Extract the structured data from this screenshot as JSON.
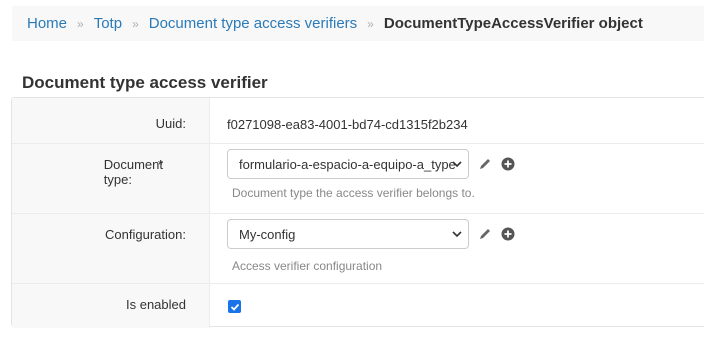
{
  "breadcrumbs": {
    "items": [
      "Home",
      "Totp",
      "Document type access verifiers"
    ],
    "separator": "»",
    "current": "DocumentTypeAccessVerifier object"
  },
  "section": {
    "title": "Document type access verifier"
  },
  "fields": {
    "uuid": {
      "label": "Uuid:",
      "value": "f0271098-ea83-4001-bd74-cd1315f2b234"
    },
    "document_type": {
      "label": "Document type:",
      "required_mark": "*",
      "selected": "formulario-a-espacio-a-equipo-a_type",
      "help": "Document type the access verifier belongs to.",
      "icons": [
        "pencil-icon",
        "plus-circle-icon"
      ]
    },
    "configuration": {
      "label": "Configuration:",
      "selected": "My-config",
      "help": "Access verifier configuration",
      "icons": [
        "pencil-icon",
        "plus-circle-icon"
      ]
    },
    "is_enabled": {
      "label": "Is enabled",
      "checked": true
    }
  },
  "colors": {
    "link": "#2a7ab8",
    "checkbox": "#1a73e8",
    "label_bg": "#f8f8f8"
  }
}
